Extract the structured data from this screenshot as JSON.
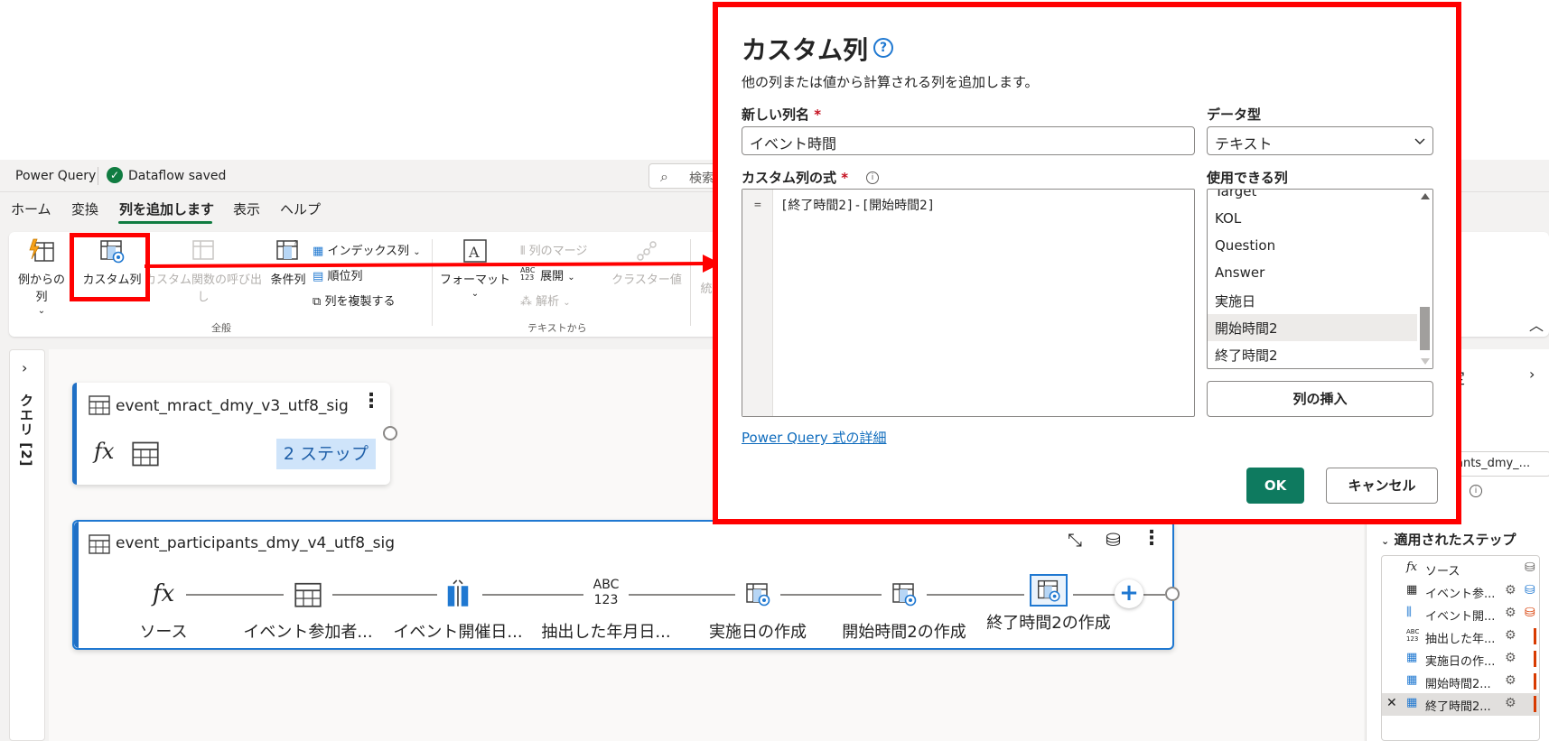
{
  "app": {
    "title": "Power Query",
    "status_text": "Dataflow saved",
    "search_text": "検索"
  },
  "menu_tabs": [
    {
      "label": "ホーム"
    },
    {
      "label": "変換"
    },
    {
      "label": "列を追加します"
    },
    {
      "label": "表示"
    },
    {
      "label": "ヘルプ"
    }
  ],
  "ribbon": {
    "example_col": "例からの列",
    "custom_col": "カスタム列",
    "invoke_custom_fn": "カスタム関数の呼び出し",
    "conditional_col": "条件列",
    "index_col": "インデックス列",
    "rank_col": "順位列",
    "duplicate_col": "列を複製する",
    "format": "フォーマット",
    "merge_cols": "列のマージ",
    "extract": "展開",
    "parse": "解析",
    "cluster_values": "クラスター値",
    "stats": "統",
    "group_general": "全般",
    "group_text": "テキストから"
  },
  "query_panel": {
    "label": "クエリ [2]"
  },
  "queries": [
    {
      "name": "event_mract_dmy_v3_utf8_sig",
      "steps_badge": "2 ステップ"
    },
    {
      "name": "event_participants_dmy_v4_utf8_sig",
      "steps": [
        {
          "label": "ソース",
          "icon": "fx-icon"
        },
        {
          "label": "イベント参加者...",
          "icon": "table-icon"
        },
        {
          "label": "イベント開催日...",
          "icon": "split-column-icon"
        },
        {
          "label": "抽出した年月日...",
          "icon": "abc123-icon"
        },
        {
          "label": "実施日の作成",
          "icon": "custom-column-icon"
        },
        {
          "label": "開始時間2の作成",
          "icon": "custom-column-icon"
        },
        {
          "label": "終了時間2の作成",
          "icon": "custom-column-icon"
        }
      ]
    }
  ],
  "right_panel": {
    "title": "定",
    "name_value": "ants_dmy_...",
    "applied_steps_title": "適用されたステップ",
    "steps": [
      {
        "label": "ソース",
        "icon": "fx-icon",
        "selected": false
      },
      {
        "label": "イベント参...",
        "icon": "table-icon",
        "selected": false
      },
      {
        "label": "イベント開...",
        "icon": "split-column-icon",
        "selected": false
      },
      {
        "label": "抽出した年...",
        "icon": "abc123-icon",
        "selected": false
      },
      {
        "label": "実施日の作...",
        "icon": "custom-column-icon",
        "selected": false
      },
      {
        "label": "開始時間2...",
        "icon": "custom-column-icon",
        "selected": false
      },
      {
        "label": "終了時間2...",
        "icon": "custom-column-icon",
        "selected": true
      }
    ]
  },
  "dialog": {
    "title": "カスタム列",
    "description": "他の列または値から計算される列を追加します。",
    "new_col_label": "新しい列名",
    "new_col_value": "イベント時間",
    "data_type_label": "データ型",
    "data_type_value": "テキスト",
    "formula_label": "カスタム列の式",
    "formula_eq": "=",
    "formula_value": "[終了時間2]-[開始時間2]",
    "available_cols_label": "使用できる列",
    "available_cols": [
      "Target",
      "KOL",
      "Question",
      "Answer",
      "実施日",
      "開始時間2",
      "終了時間2"
    ],
    "selected_col": "開始時間2",
    "insert_button": "列の挿入",
    "link_text": "Power Query 式の詳細",
    "ok_button": "OK",
    "cancel_button": "キャンセル",
    "required_mark": "*"
  },
  "colors": {
    "accent_green": "#107c41",
    "ok_green": "#0e7a5f",
    "highlight_red": "#ff0000",
    "card_blue": "#1f78d1"
  }
}
